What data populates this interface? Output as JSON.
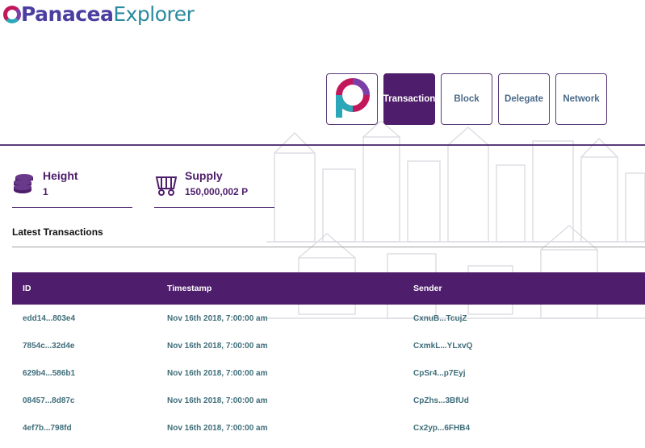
{
  "app": {
    "logo_part1": "Panacea",
    "logo_part2": "Explorer"
  },
  "nav": [
    {
      "label": "Transaction",
      "active": true
    },
    {
      "label": "Block",
      "active": false
    },
    {
      "label": "Delegate",
      "active": false
    },
    {
      "label": "Network",
      "active": false
    }
  ],
  "stats": {
    "height": {
      "label": "Height",
      "value": "1"
    },
    "supply": {
      "label": "Supply",
      "value": "150,000,002 P"
    }
  },
  "latest": {
    "title": "Latest Transactions",
    "columns": [
      "ID",
      "Timestamp",
      "Sender"
    ],
    "rows": [
      {
        "id": "edd14...803e4",
        "timestamp": "Nov 16th 2018, 7:00:00 am",
        "sender": "CxnuB...TcujZ"
      },
      {
        "id": "7854c...32d4e",
        "timestamp": "Nov 16th 2018, 7:00:00 am",
        "sender": "CxmkL...YLxvQ"
      },
      {
        "id": "629b4...586b1",
        "timestamp": "Nov 16th 2018, 7:00:00 am",
        "sender": "CpSr4...p7Eyj"
      },
      {
        "id": "08457...8d87c",
        "timestamp": "Nov 16th 2018, 7:00:00 am",
        "sender": "CpZhs...3BfUd"
      },
      {
        "id": "4ef7b...798fd",
        "timestamp": "Nov 16th 2018, 7:00:00 am",
        "sender": "Cx2yp...6FHB4"
      }
    ]
  },
  "colors": {
    "brand": "#4e1d6b",
    "accent": "#2a8a9e",
    "link": "#3f6e7a"
  },
  "icons": {
    "height": "coin-stack-icon",
    "supply": "mine-cart-icon",
    "nav_logo": "panacea-p-logo-icon"
  }
}
